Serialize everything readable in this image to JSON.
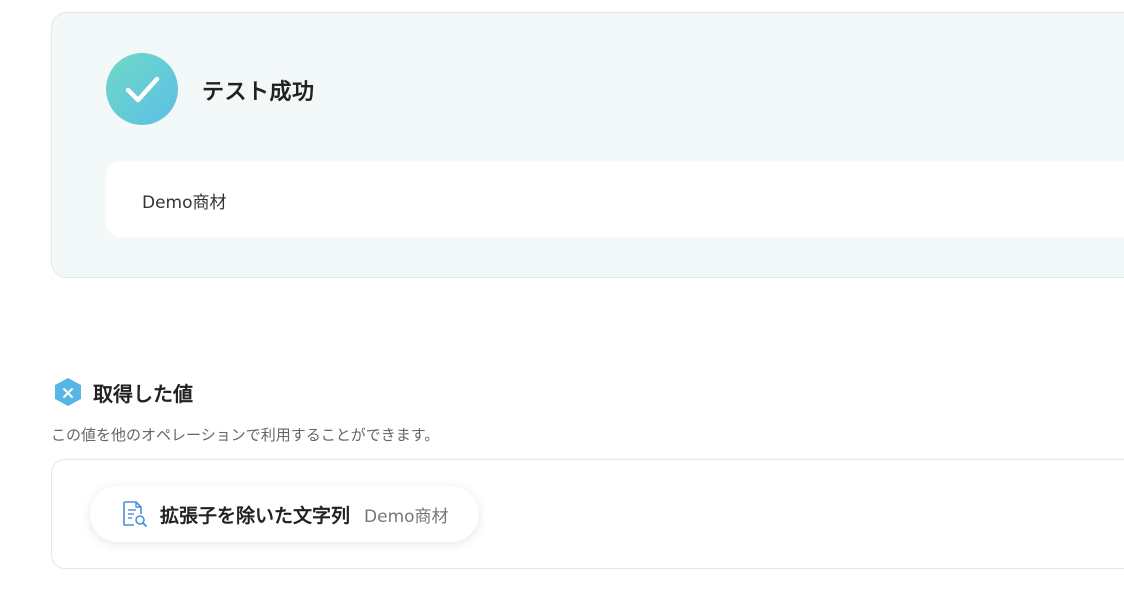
{
  "test_result": {
    "title": "テスト成功",
    "output_value": "Demo商材",
    "status_icon": "checkmark-icon",
    "accent_gradient": [
      "#6fd8c6",
      "#5cbfe6"
    ]
  },
  "acquired_values": {
    "title": "取得した値",
    "description": "この値を他のオペレーションで利用することができます。",
    "section_icon": "variable-badge-icon",
    "items": [
      {
        "label": "拡張子を除いた文字列",
        "value": "Demo商材",
        "icon": "document-search-icon"
      }
    ]
  }
}
